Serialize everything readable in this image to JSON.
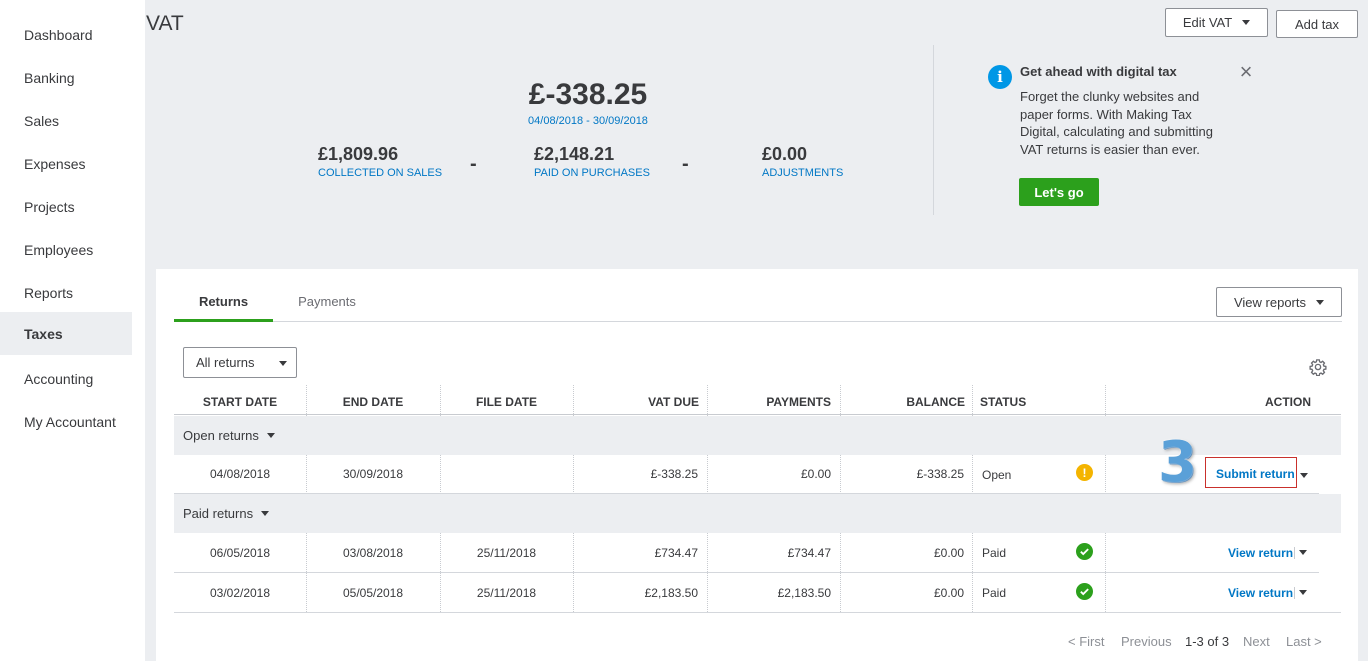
{
  "sidebar": {
    "items": [
      {
        "label": "Dashboard"
      },
      {
        "label": "Banking"
      },
      {
        "label": "Sales"
      },
      {
        "label": "Expenses"
      },
      {
        "label": "Projects"
      },
      {
        "label": "Employees"
      },
      {
        "label": "Reports"
      },
      {
        "label": "Taxes",
        "active": true
      },
      {
        "label": "Accounting"
      },
      {
        "label": "My Accountant"
      }
    ]
  },
  "header": {
    "title": "VAT",
    "edit_vat_label": "Edit VAT",
    "add_tax_label": "Add tax"
  },
  "summary": {
    "net_amount": "£-338.25",
    "period": "04/08/2018 - 30/09/2018",
    "collected_amount": "£1,809.96",
    "collected_label": "COLLECTED ON SALES",
    "paid_amount": "£2,148.21",
    "paid_label": "PAID ON PURCHASES",
    "adjustments_amount": "£0.00",
    "adjustments_label": "ADJUSTMENTS",
    "operator": "-"
  },
  "promo": {
    "title": "Get ahead with digital tax",
    "body": "Forget the clunky websites and paper forms. With Making Tax Digital, calculating and submitting VAT returns is easier than ever.",
    "button_label": "Let's go",
    "info_glyph": "i",
    "close_glyph": "×"
  },
  "tabs": [
    {
      "label": "Returns",
      "active": true
    },
    {
      "label": "Payments",
      "active": false
    }
  ],
  "view_reports_label": "View reports",
  "filter": {
    "selected": "All returns"
  },
  "table": {
    "columns": [
      "START DATE",
      "END DATE",
      "FILE DATE",
      "VAT DUE",
      "PAYMENTS",
      "BALANCE",
      "STATUS",
      "ACTION"
    ],
    "groups": [
      {
        "label": "Open returns",
        "rows": [
          {
            "start": "04/08/2018",
            "end": "30/09/2018",
            "file": "",
            "vat_due": "£-338.25",
            "payments": "£0.00",
            "balance": "£-338.25",
            "status": "Open",
            "status_icon": "warning-icon",
            "action": "Submit return"
          }
        ]
      },
      {
        "label": "Paid returns",
        "rows": [
          {
            "start": "06/05/2018",
            "end": "03/08/2018",
            "file": "25/11/2018",
            "vat_due": "£734.47",
            "payments": "£734.47",
            "balance": "£0.00",
            "status": "Paid",
            "status_icon": "check-icon",
            "action": "View return"
          },
          {
            "start": "03/02/2018",
            "end": "05/05/2018",
            "file": "25/11/2018",
            "vat_due": "£2,183.50",
            "payments": "£2,183.50",
            "balance": "£0.00",
            "status": "Paid",
            "status_icon": "check-icon",
            "action": "View return"
          }
        ]
      }
    ]
  },
  "pagination": {
    "first": "< First",
    "previous": "Previous",
    "range": "1-3 of 3",
    "next": "Next",
    "last": "Last >"
  },
  "annotation": {
    "step": "3"
  },
  "colors": {
    "accent_green": "#2ca01c",
    "link_blue": "#0077c5",
    "warning": "#f4b400",
    "highlight_red": "#c9302c",
    "background": "#eceef1"
  }
}
